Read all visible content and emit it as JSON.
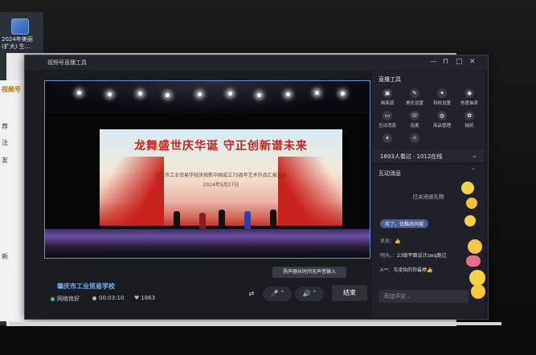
{
  "desktop": {
    "icons": [
      {
        "label": "2024年美丽",
        "sub": "(扩大) 生..."
      },
      {
        "label": "",
        "sub": ""
      }
    ]
  },
  "background_page": {
    "nav": [
      "视频号",
      "荐",
      "注",
      "友",
      "新"
    ]
  },
  "window": {
    "title": "视频号直播工具",
    "controls": {
      "minimize": "—",
      "pin": "⊓",
      "maximize": "□",
      "close": "✕"
    }
  },
  "video": {
    "banner_title": "龙舞盛世庆华诞  守正创新谱未来",
    "banner_subtitle": "肇庆市工业贸易学校庆祝新中国成立75周年艺术作品汇报演出",
    "banner_date": "2024年9月27日"
  },
  "stream_bar": {
    "school": "肇庆市工业贸易学校",
    "network_status": "网络良好",
    "duration": "00:03:10",
    "likes": "1863",
    "tooltip": "扬声器长时间无声音输入",
    "end_button": "结束"
  },
  "tools_panel": {
    "title": "直播工具",
    "items": [
      {
        "label": "画面源",
        "icon": "screen-source-icon",
        "glyph": "▣"
      },
      {
        "label": "美化设置",
        "icon": "beauty-icon",
        "glyph": "✎"
      },
      {
        "label": "特效设置",
        "icon": "effects-icon",
        "glyph": "✦"
      },
      {
        "label": "热度抽奖",
        "icon": "lottery-icon",
        "glyph": "◉"
      },
      {
        "label": "互动消息",
        "icon": "message-icon",
        "glyph": "▭"
      },
      {
        "label": "连麦",
        "icon": "co-host-icon",
        "glyph": "☏"
      },
      {
        "label": "商品管理",
        "icon": "goods-icon",
        "glyph": "◍"
      },
      {
        "label": "抽奖",
        "icon": "draw-icon",
        "glyph": "✿"
      },
      {
        "label": "",
        "icon": "more-icon-1",
        "glyph": "▾"
      },
      {
        "label": "",
        "icon": "more-icon-2",
        "glyph": "✧"
      }
    ]
  },
  "online": {
    "text": "1693人看过 · 1012在线"
  },
  "messages": {
    "title": "互动消息",
    "gift_status": "已关闭送礼物",
    "items": [
      {
        "user": "",
        "text": "欢了，优酷尚同城"
      },
      {
        "user": "吴吴：",
        "text": "👍"
      },
      {
        "user": "明天。：",
        "text": "23级平面设计zwq跑过"
      },
      {
        "user": "A**：",
        "text": "韦凌怡的你最棒👍"
      }
    ],
    "input_placeholder": "添加评论..."
  },
  "colors": {
    "accent": "#6b8fd6",
    "stage_red": "#c8201a",
    "network_ok": "#3fc56b",
    "panel": "#22232a"
  }
}
